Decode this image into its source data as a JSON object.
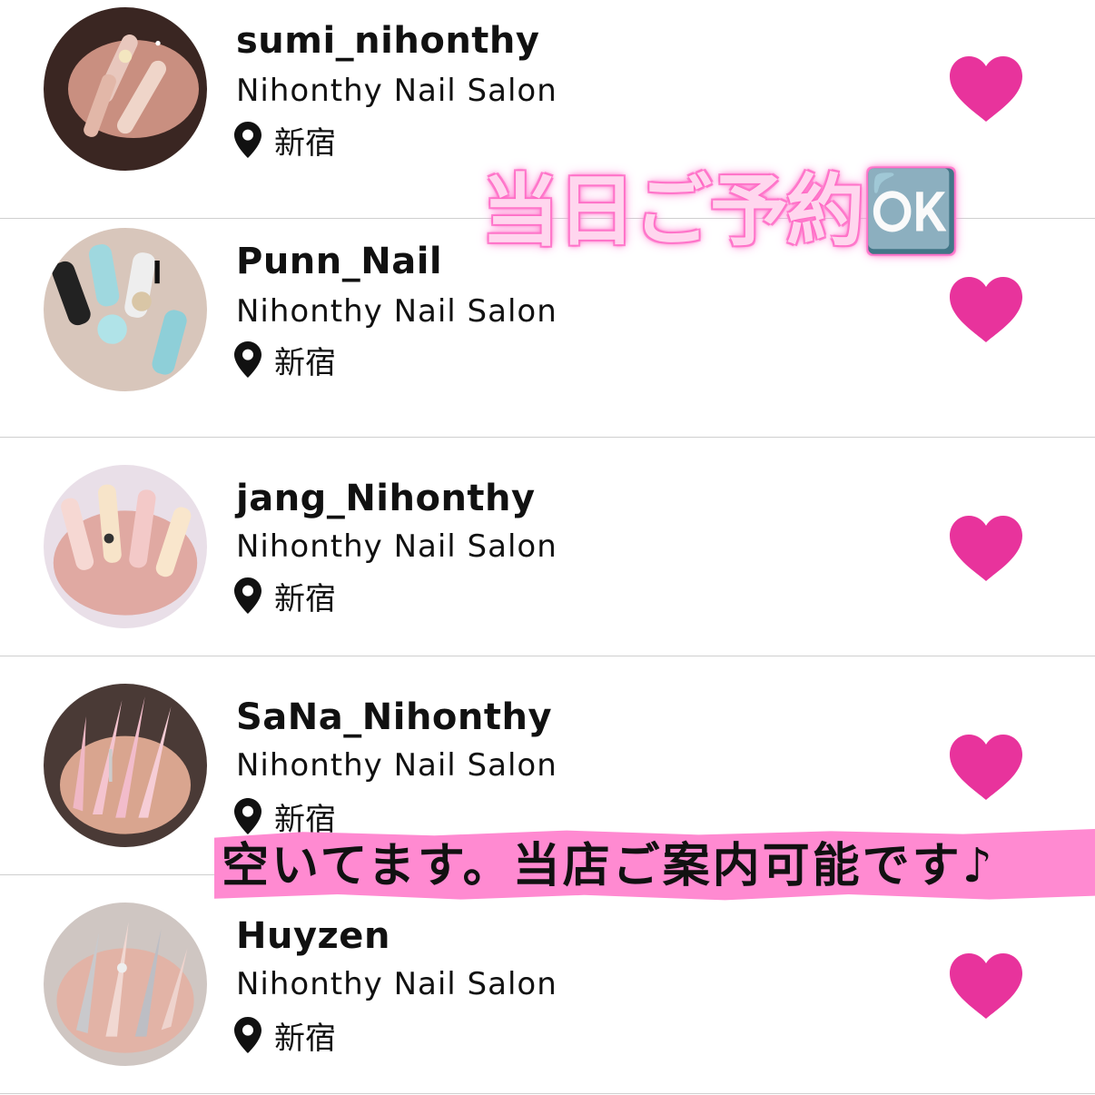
{
  "items": [
    {
      "name": "sumi_nihonthy",
      "salon": "Nihonthy Nail Salon",
      "location": "新宿"
    },
    {
      "name": "Punn_Nail",
      "salon": "Nihonthy Nail Salon",
      "location": "新宿"
    },
    {
      "name": "jang_Nihonthy",
      "salon": "Nihonthy Nail Salon",
      "location": "新宿"
    },
    {
      "name": "SaNa_Nihonthy",
      "salon": "Nihonthy Nail Salon",
      "location": "新宿"
    },
    {
      "name": "Huyzen",
      "salon": "Nihonthy Nail Salon",
      "location": "新宿"
    }
  ],
  "overlay": {
    "same_day": "当日ご予約🆗",
    "available": "空いてます。当店ご案内可能です♪"
  },
  "colors": {
    "heart": "#e8339c",
    "band": "#ff8ad1",
    "divider": "#cfcfcf"
  },
  "icons": {
    "favorite": "heart-icon",
    "location": "map-pin-icon"
  }
}
